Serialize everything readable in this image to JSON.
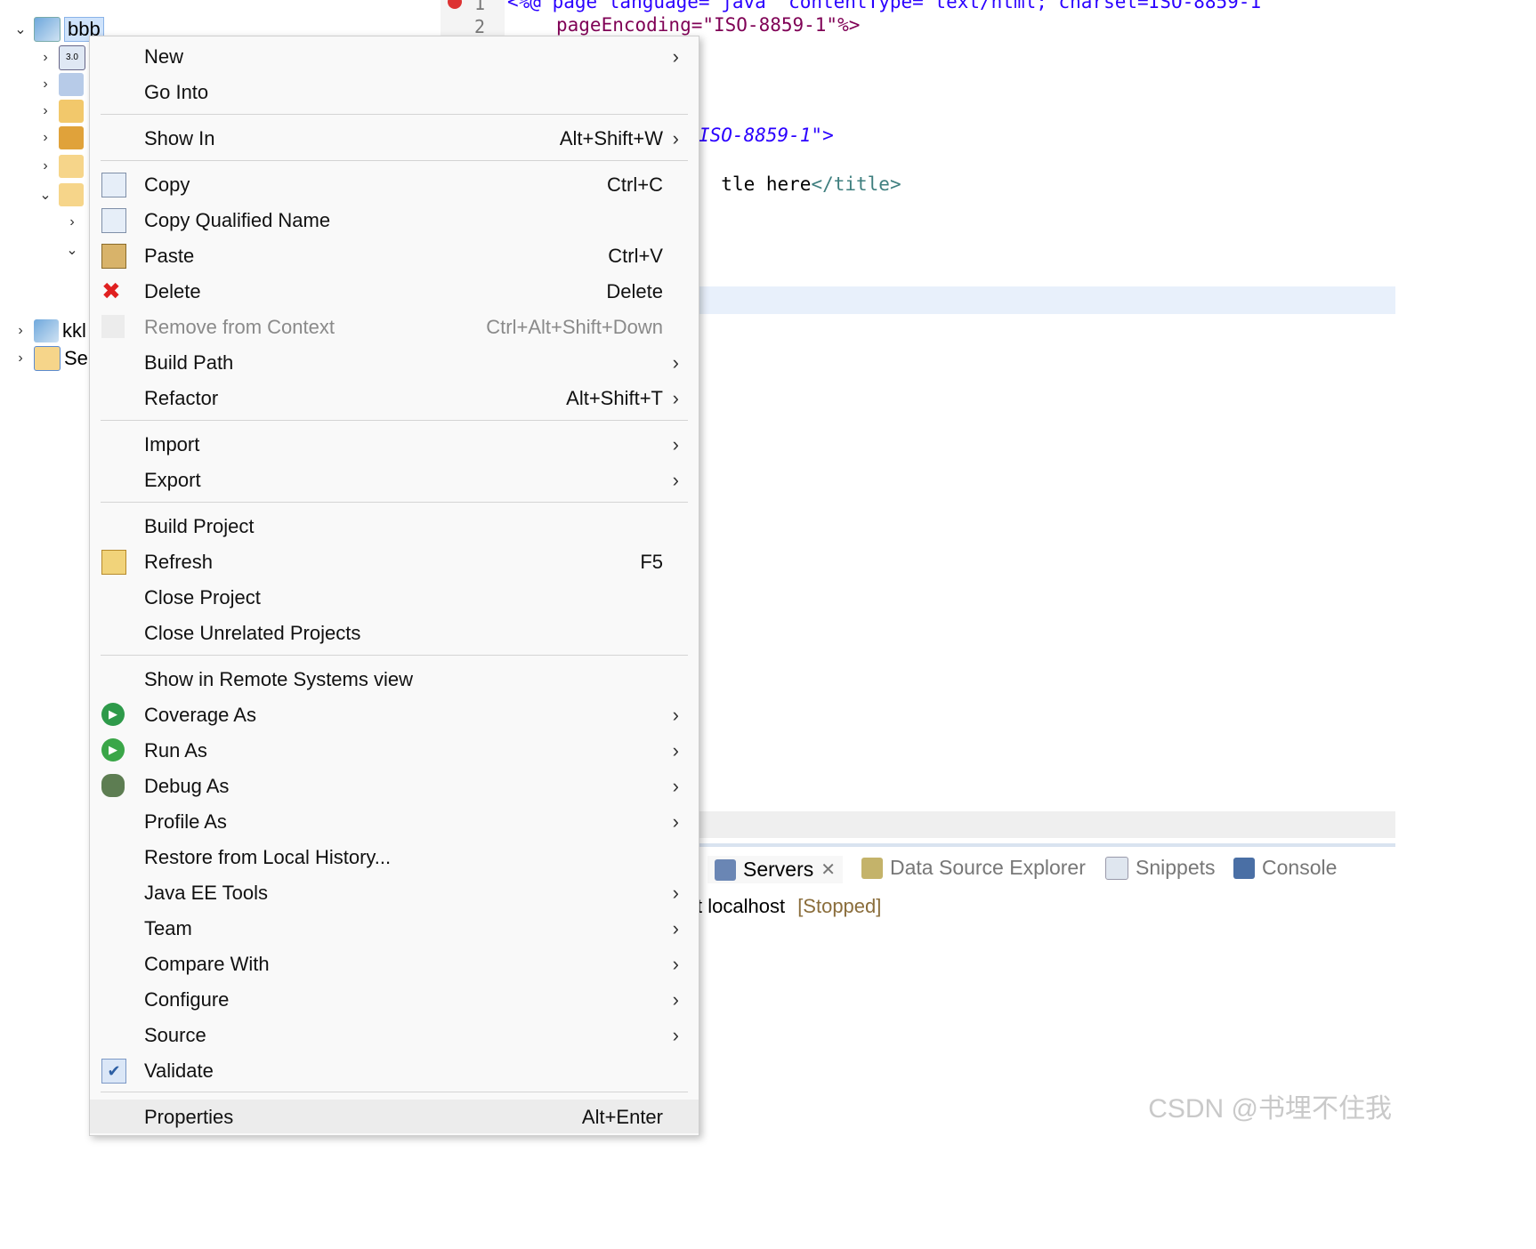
{
  "explorer": {
    "projects": [
      {
        "name": "bbb"
      },
      {
        "name": "kkl"
      },
      {
        "name": "Se"
      }
    ],
    "version_badge": "3.0"
  },
  "editor": {
    "lines": [
      {
        "num": "1",
        "code": "<%@ page language=\"java\" contentType=\"text/html; charset=ISO-8859-1\""
      },
      {
        "num": "2",
        "code": "pageEncoding=\"ISO-8859-1\"%>"
      }
    ],
    "fragment_charset": "ISO-8859-1\">",
    "fragment_title_pre": "tle here",
    "fragment_title_close": "</title>"
  },
  "bottom_panel": {
    "tabs": [
      "Servers",
      "Data Source Explorer",
      "Snippets",
      "Console"
    ],
    "server_name": "t localhost",
    "server_status": "[Stopped]"
  },
  "context_menu": {
    "items": [
      {
        "label": "New",
        "accel": "",
        "submenu": true,
        "icon": ""
      },
      {
        "label": "Go Into",
        "accel": "",
        "submenu": false,
        "icon": ""
      },
      {
        "label": "Show In",
        "accel": "Alt+Shift+W",
        "submenu": true,
        "icon": ""
      },
      {
        "label": "Copy",
        "accel": "Ctrl+C",
        "submenu": false,
        "icon": "copy-icon"
      },
      {
        "label": "Copy Qualified Name",
        "accel": "",
        "submenu": false,
        "icon": "copy-qualified-name-icon"
      },
      {
        "label": "Paste",
        "accel": "Ctrl+V",
        "submenu": false,
        "icon": "paste-icon"
      },
      {
        "label": "Delete",
        "accel": "Delete",
        "submenu": false,
        "icon": "delete-icon"
      },
      {
        "label": "Remove from Context",
        "accel": "Ctrl+Alt+Shift+Down",
        "submenu": false,
        "icon": "remove-context-icon",
        "disabled": true
      },
      {
        "label": "Build Path",
        "accel": "",
        "submenu": true,
        "icon": ""
      },
      {
        "label": "Refactor",
        "accel": "Alt+Shift+T",
        "submenu": true,
        "icon": ""
      },
      {
        "label": "Import",
        "accel": "",
        "submenu": true,
        "icon": ""
      },
      {
        "label": "Export",
        "accel": "",
        "submenu": true,
        "icon": ""
      },
      {
        "label": "Build Project",
        "accel": "",
        "submenu": false,
        "icon": ""
      },
      {
        "label": "Refresh",
        "accel": "F5",
        "submenu": false,
        "icon": "refresh-icon"
      },
      {
        "label": "Close Project",
        "accel": "",
        "submenu": false,
        "icon": ""
      },
      {
        "label": "Close Unrelated Projects",
        "accel": "",
        "submenu": false,
        "icon": ""
      },
      {
        "label": "Show in Remote Systems view",
        "accel": "",
        "submenu": false,
        "icon": ""
      },
      {
        "label": "Coverage As",
        "accel": "",
        "submenu": true,
        "icon": "coverage-icon"
      },
      {
        "label": "Run As",
        "accel": "",
        "submenu": true,
        "icon": "run-icon"
      },
      {
        "label": "Debug As",
        "accel": "",
        "submenu": true,
        "icon": "debug-bug-icon"
      },
      {
        "label": "Profile As",
        "accel": "",
        "submenu": true,
        "icon": ""
      },
      {
        "label": "Restore from Local History...",
        "accel": "",
        "submenu": false,
        "icon": ""
      },
      {
        "label": "Java EE Tools",
        "accel": "",
        "submenu": true,
        "icon": ""
      },
      {
        "label": "Team",
        "accel": "",
        "submenu": true,
        "icon": ""
      },
      {
        "label": "Compare With",
        "accel": "",
        "submenu": true,
        "icon": ""
      },
      {
        "label": "Configure",
        "accel": "",
        "submenu": true,
        "icon": ""
      },
      {
        "label": "Source",
        "accel": "",
        "submenu": true,
        "icon": ""
      },
      {
        "label": "Validate",
        "accel": "",
        "submenu": false,
        "icon": "validate-check-icon"
      },
      {
        "label": "Properties",
        "accel": "Alt+Enter",
        "submenu": false,
        "icon": ""
      }
    ]
  },
  "watermark": "CSDN @书埋不住我",
  "colors": {
    "menu_bg": "#f9f9f9",
    "highlight": "#ececec",
    "keyword": "#7f0055",
    "string": "#2a00ff",
    "status": "#8a6d3b"
  }
}
